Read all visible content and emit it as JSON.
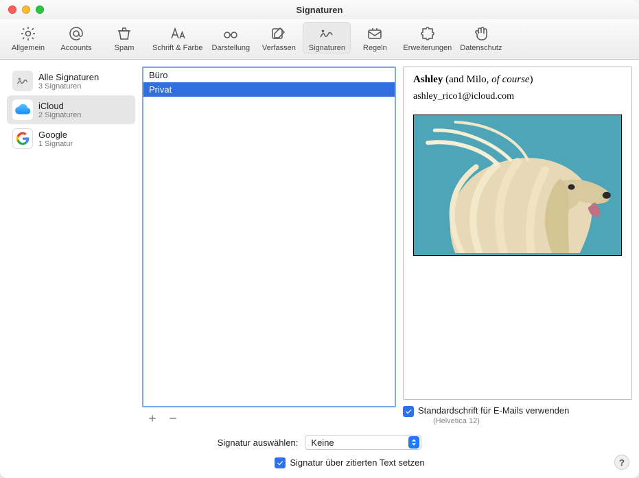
{
  "window": {
    "title": "Signaturen"
  },
  "toolbar": {
    "items": [
      {
        "id": "prefs-general",
        "label": "Allgemein"
      },
      {
        "id": "prefs-accounts",
        "label": "Accounts"
      },
      {
        "id": "prefs-junk",
        "label": "Spam"
      },
      {
        "id": "prefs-fonts",
        "label": "Schrift & Farbe"
      },
      {
        "id": "prefs-viewing",
        "label": "Darstellung"
      },
      {
        "id": "prefs-composing",
        "label": "Verfassen"
      },
      {
        "id": "prefs-signatures",
        "label": "Signaturen"
      },
      {
        "id": "prefs-rules",
        "label": "Regeln"
      },
      {
        "id": "prefs-extensions",
        "label": "Erweiterungen"
      },
      {
        "id": "prefs-privacy",
        "label": "Datenschutz"
      }
    ],
    "selected": "prefs-signatures"
  },
  "accounts": [
    {
      "id": "all",
      "name": "Alle Signaturen",
      "sub": "3 Signaturen"
    },
    {
      "id": "icloud",
      "name": "iCloud",
      "sub": "2 Signaturen",
      "selected": true
    },
    {
      "id": "google",
      "name": "Google",
      "sub": "1 Signatur"
    }
  ],
  "signatures": [
    {
      "name": "Büro"
    },
    {
      "name": "Privat",
      "selected": true
    }
  ],
  "buttons": {
    "add_tip": "+",
    "remove_tip": "−"
  },
  "preview": {
    "name_bold": "Ashley",
    "name_plain": " (and Milo, ",
    "name_italic": "of course",
    "name_tail": ")",
    "email": "ashley_rico1@icloud.com"
  },
  "options": {
    "use_default_font_label": "Standardschrift für E-Mails verwenden",
    "use_default_font_sub": "(Helvetica 12)",
    "use_default_font_checked": true,
    "choose_label": "Signatur auswählen:",
    "choose_value": "Keine",
    "above_quoted_label": "Signatur über zitierten Text setzen",
    "above_quoted_checked": true
  },
  "help": {
    "glyph": "?"
  }
}
